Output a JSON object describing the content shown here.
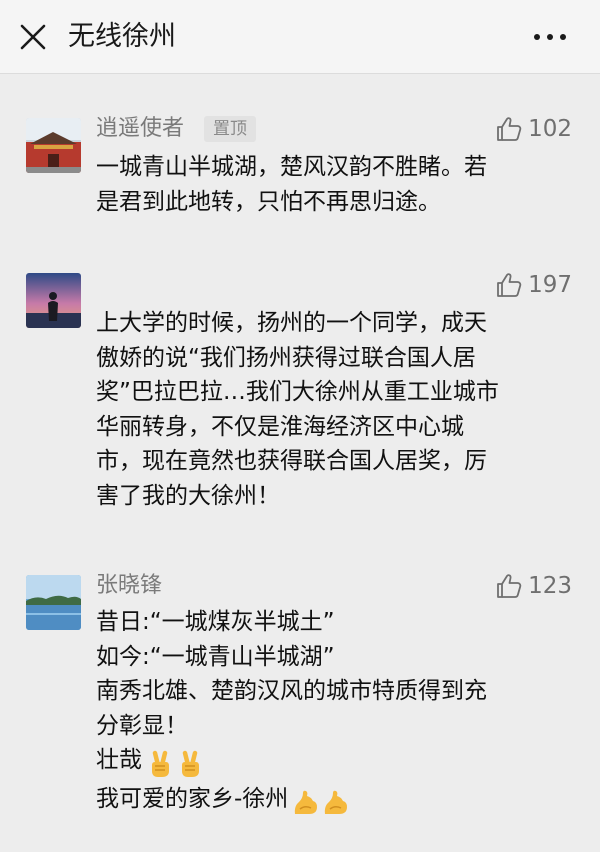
{
  "header": {
    "title": "无线徐州",
    "close_icon": "close-icon",
    "more_icon": "more-dots-icon"
  },
  "comments": [
    {
      "author": "逍遥使者",
      "badge": "置顶",
      "likes": "102",
      "avatar_icon": "palace-gate-avatar",
      "lines": [
        "一城青山半城湖，楚风汉韵不胜睹。若",
        "是君到此地转，只怕不再思归途。"
      ]
    },
    {
      "author": "",
      "likes": "197",
      "avatar_icon": "sunset-silhouette-avatar",
      "lines": [
        "上大学的时候，扬州的一个同学，成天",
        "傲娇的说“我们扬州获得过联合国人居",
        "奖”巴拉巴拉…我们大徐州从重工业城市",
        "华丽转身，不仅是淮海经济区中心城",
        "市，现在竟然也获得联合国人居奖，厉",
        "害了我的大徐州！"
      ]
    },
    {
      "author": "张晓锋",
      "likes": "123",
      "avatar_icon": "lake-landscape-avatar",
      "lines": [
        "昔日:“一城煤灰半城土”",
        "如今:“一城青山半城湖”",
        "南秀北雄、楚韵汉风的城市特质得到充",
        "分彰显！",
        "壮哉",
        "我可爱的家乡-徐州"
      ],
      "emoji": {
        "line5": [
          "victory-hand-emoji",
          "victory-hand-emoji"
        ],
        "line6": [
          "flexed-biceps-emoji",
          "flexed-biceps-emoji"
        ]
      }
    }
  ],
  "colors": {
    "background": "#ededed",
    "topbar": "#f5f5f5",
    "nickname": "#7a7a7a",
    "text": "#111111",
    "badge_bg": "#e2e2e2"
  },
  "like_icon": "thumbs-up-icon"
}
